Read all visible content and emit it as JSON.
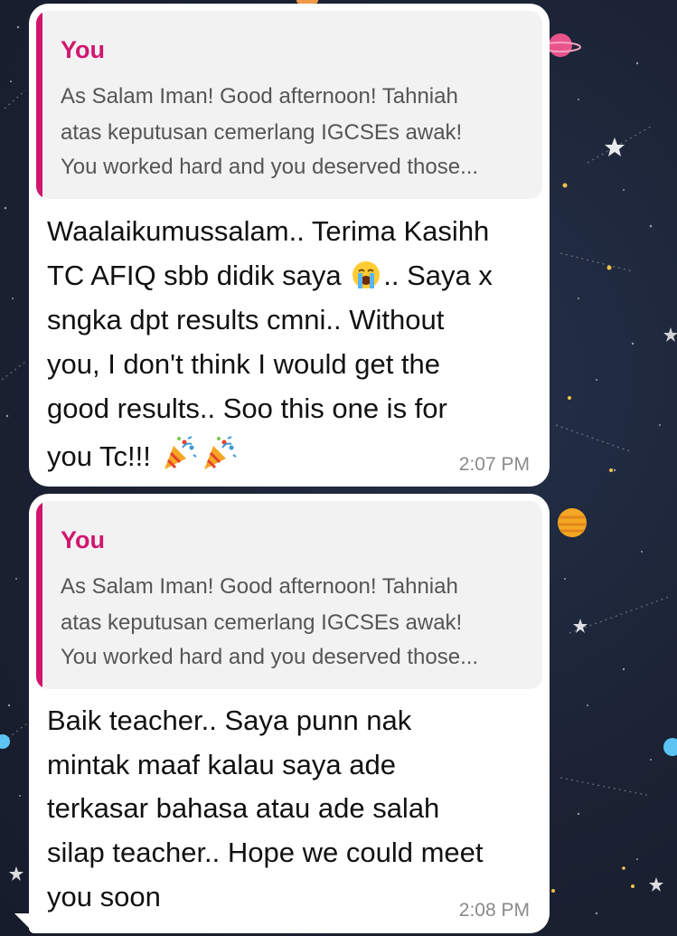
{
  "messages": [
    {
      "reply": {
        "author": "You",
        "lines": [
          "As Salam Iman! Good afternoon! Tahniah",
          "atas keputusan cemerlang IGCSEs awak!",
          "You worked hard and you deserved those..."
        ]
      },
      "lines": {
        "l1": "Waalaikumussalam.. Terima Kasihh",
        "l2_before": "TC AFIQ sbb didik saya ",
        "l2_after": ".. Saya x",
        "l3": "sngka dpt results cmni..  Without",
        "l4": "you, I don't think I would get the",
        "l5": "good results.. Soo this one is for",
        "l6": "you Tc!!! "
      },
      "time": "2:07 PM",
      "emojis": [
        "loudly-crying-face-emoji",
        "party-popper-emoji",
        "party-popper-emoji"
      ]
    },
    {
      "reply": {
        "author": "You",
        "lines": [
          "As Salam Iman! Good afternoon! Tahniah",
          "atas keputusan cemerlang IGCSEs awak!",
          "You worked hard and you deserved those..."
        ]
      },
      "lines": [
        "Baik teacher.. Saya punn nak",
        "mintak maaf kalau saya ade",
        "terkasar bahasa atau ade salah",
        "silap teacher.. Hope we could meet",
        "you soon"
      ],
      "time": "2:08 PM"
    }
  ],
  "colors": {
    "wallpaper": "#1b2233",
    "bubble": "#ffffff",
    "quote_background": "#f2f2f2",
    "accent": "#d1166f",
    "timestamp": "#8a8a8a"
  }
}
